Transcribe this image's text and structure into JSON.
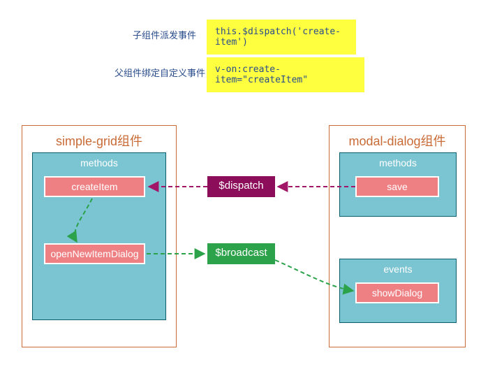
{
  "legend": {
    "row1": {
      "label": "子组件派发事件",
      "code": "this.$dispatch('create-item')"
    },
    "row2": {
      "label": "父组件绑定自定义事件",
      "code": "v-on:create-item=\"createItem\""
    }
  },
  "left": {
    "title": "simple-grid组件",
    "panel_title": "methods",
    "methods": {
      "createItem": "createItem",
      "openNewItemDialog": "openNewItemDialog"
    }
  },
  "right": {
    "title": "modal-dialog组件",
    "methods_title": "methods",
    "methods": {
      "save": "save"
    },
    "events_title": "events",
    "events": {
      "showDialog": "showDialog"
    }
  },
  "bus": {
    "dispatch": "$dispatch",
    "broadcast": "$broadcast"
  },
  "colors": {
    "dispatch_bg": "#8c0e5a",
    "broadcast_bg": "#2ca24a",
    "dispatch_line": "#a21668",
    "broadcast_line": "#2ca24a"
  }
}
